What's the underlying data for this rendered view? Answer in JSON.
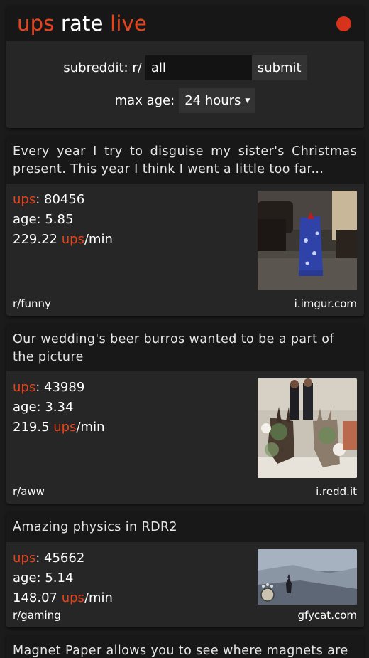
{
  "header": {
    "brand_ups": "ups",
    "brand_rate": "rate",
    "brand_live": "live",
    "subreddit_label": "subreddit: r/",
    "subreddit_value": "all",
    "submit_label": "submit",
    "max_age_label": "max age:",
    "max_age_value": "24 hours"
  },
  "colors": {
    "accent": "#e8431b",
    "live_dot": "#d7321b",
    "card": "#262626",
    "title_bar": "#181818"
  },
  "posts": [
    {
      "title": "Every year I try to disguise my sister's Christmas present. This year I think I went a little too far...",
      "ups_label": "ups",
      "ups": "80456",
      "age_label": "age:",
      "age": "5.85",
      "rate": "229.22",
      "rate_ups": "ups",
      "rate_unit": "/min",
      "subreddit": "r/funny",
      "domain": "i.imgur.com"
    },
    {
      "title": "Our wedding's beer burros wanted to be a part of the picture",
      "ups_label": "ups",
      "ups": "43989",
      "age_label": "age:",
      "age": "3.34",
      "rate": "219.5",
      "rate_ups": "ups",
      "rate_unit": "/min",
      "subreddit": "r/aww",
      "domain": "i.redd.it"
    },
    {
      "title": "Amazing physics in RDR2",
      "ups_label": "ups",
      "ups": "45662",
      "age_label": "age:",
      "age": "5.14",
      "rate": "148.07",
      "rate_ups": "ups",
      "rate_unit": "/min",
      "subreddit": "r/gaming",
      "domain": "gfycat.com"
    },
    {
      "title": "Magnet Paper allows you to see where magnets are"
    }
  ]
}
